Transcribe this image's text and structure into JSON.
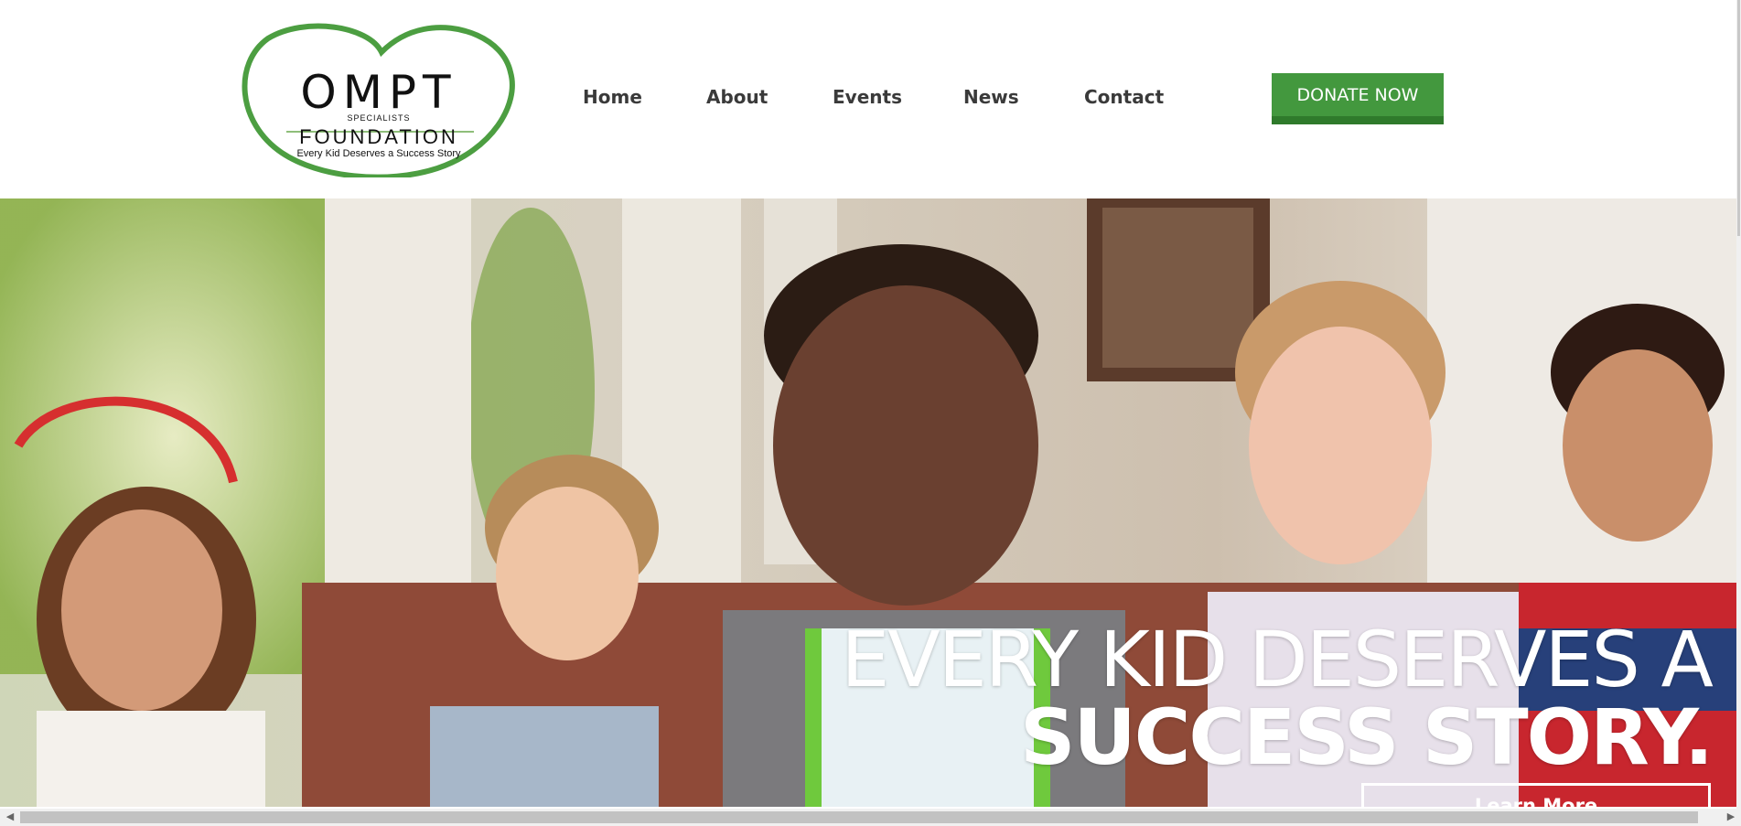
{
  "logo": {
    "title": "OMPT",
    "specialists": "SPECIALISTS",
    "foundation": "FOUNDATION",
    "tagline": "Every Kid Deserves a Success Story"
  },
  "nav": {
    "items": [
      {
        "label": "Home"
      },
      {
        "label": "About"
      },
      {
        "label": "Events"
      },
      {
        "label": "News"
      },
      {
        "label": "Contact"
      }
    ]
  },
  "donate": {
    "label": "DONATE NOW"
  },
  "hero": {
    "line1": "EVERY KID DESERVES A",
    "line2": "SUCCESS STORY.",
    "cta_label": "Learn More"
  },
  "colors": {
    "brand_green": "#43983e",
    "nav_text": "#3a3a3a",
    "heart_outline": "#4c9e41"
  },
  "icons": {
    "scroll_left": "triangle-left-icon",
    "scroll_right": "triangle-right-icon"
  }
}
